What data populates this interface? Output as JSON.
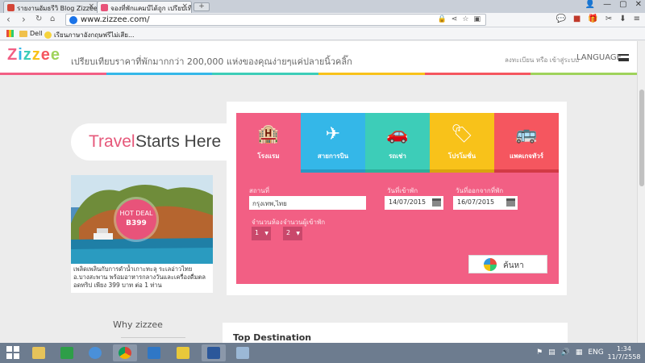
{
  "browser": {
    "tabs": [
      {
        "label": "รายงานอัมธรีวิ Blog Zizzee Bo",
        "active": false
      },
      {
        "label": "จองที่พักแคมป์ได้ถูก เปรียบเทียบรา",
        "active": true
      }
    ],
    "new_tab": "+",
    "url": "www.zizzee.com/",
    "bookmarks": [
      {
        "label": "Dell"
      },
      {
        "label": "เรียนภาษาอังกฤษฟรีไม่เสีย..."
      }
    ]
  },
  "site": {
    "logo": "Zizzee",
    "tagline": "เปรียบเทียบราคาที่พักมากกว่า 200,000 แห่งของคุณง่ายๆแค่ปลายนิ้วคลิ๊ก",
    "login_links": "ลงทะเบียน หรือ เข้าสู่ระบบ",
    "language": "LANGUAGE",
    "colorbar": [
      "#f25f84",
      "#34b7e8",
      "#3dcdb8",
      "#f8c21a",
      "#f5565f",
      "#9fd35b"
    ],
    "hero": {
      "word1": "Travel",
      "word2": "Starts Here"
    },
    "deal": {
      "badge_top": "HOT DEAL",
      "badge_price": "B399",
      "caption": "เพลิดเพลินกับการดำน้ำเกาะทะลุ ระเลอ่าวไทย อ.บางสะพาน พร้อมอาหารกลางวันและเครื่องดื่มตลอดทริป เพียง 399 บาท ต่อ 1 ท่าน"
    },
    "why": "Why zizzee",
    "booking": {
      "categories": [
        {
          "label": "โรงแรม",
          "icon": "hotel-icon",
          "glyph": "🏨",
          "color": "#f25f84",
          "strip": "#f25f84"
        },
        {
          "label": "สายการบิน",
          "icon": "plane-icon",
          "glyph": "✈",
          "color": "#34b7e8",
          "strip": "#2a98c4"
        },
        {
          "label": "รถเช่า",
          "icon": "car-icon",
          "glyph": "🚗",
          "color": "#3dcdb8",
          "strip": "#2fae9a"
        },
        {
          "label": "โปรโมชั่น",
          "icon": "tag-icon",
          "glyph": "🏷",
          "color": "#f8c21a",
          "strip": "#d9a40d"
        },
        {
          "label": "แพคเกจทัวร์",
          "icon": "tour-package-icon",
          "glyph": "🚌",
          "color": "#f5565f",
          "strip": "#d23a45"
        }
      ],
      "place_label": "สถานที่",
      "place_value": "กรุงเทพ,ไทย",
      "checkin_label": "วันที่เข้าพัก",
      "checkin_value": "14/07/2015",
      "checkout_label": "วันที่ออกจากที่พัก",
      "checkout_value": "16/07/2015",
      "rooms_label": "จำนวนห้อง",
      "rooms_value": "1",
      "guests_label": "จำนวนผู้เข้าพัก",
      "guests_value": "2",
      "search_label": "ค้นหา"
    },
    "top_destination": "Top Destination"
  },
  "taskbar": {
    "tray_lang": "ENG",
    "time": "1:34",
    "date": "11/7/2558"
  }
}
